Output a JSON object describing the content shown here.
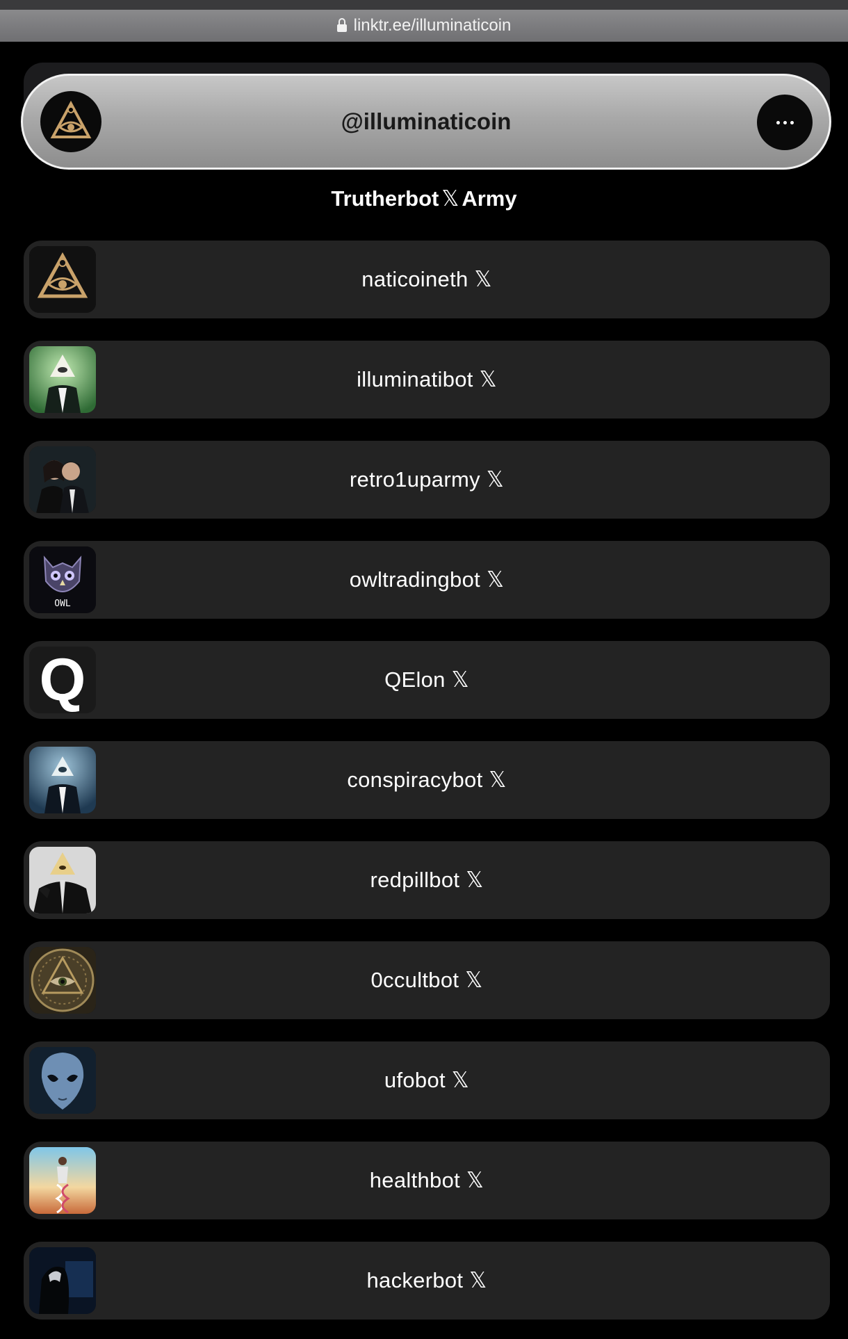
{
  "browser": {
    "url": "linktr.ee/illuminaticoin"
  },
  "profile": {
    "handle": "@illuminaticoin",
    "avatar_icon": "eye-triangle-icon",
    "more_icon": "more-icon"
  },
  "section": {
    "title_before": "Trutherbot",
    "title_x": "𝕏",
    "title_after": "Army"
  },
  "links": [
    {
      "label": "naticoineth 𝕏",
      "thumb": "eye-triangle-icon"
    },
    {
      "label": "illuminatibot 𝕏",
      "thumb": "pyramid-suit-icon"
    },
    {
      "label": "retro1uparmy 𝕏",
      "thumb": "couple-photo-icon"
    },
    {
      "label": "owltradingbot 𝕏",
      "thumb": "owl-logo-icon",
      "thumb_text": "OWL"
    },
    {
      "label": "QElon 𝕏",
      "thumb": "q-letter-icon",
      "thumb_text": "Q"
    },
    {
      "label": "conspiracybot 𝕏",
      "thumb": "pyramid-head-icon"
    },
    {
      "label": "redpillbot 𝕏",
      "thumb": "pyramid-hands-icon"
    },
    {
      "label": "0ccultbot 𝕏",
      "thumb": "occult-eye-icon"
    },
    {
      "label": "ufobot 𝕏",
      "thumb": "alien-icon"
    },
    {
      "label": "healthbot 𝕏",
      "thumb": "dna-figure-icon"
    },
    {
      "label": "hackerbot 𝕏",
      "thumb": "hacker-icon"
    }
  ],
  "colors": {
    "background": "#000000",
    "card": "#232323",
    "text": "#ffffff",
    "gold": "#c9a26a"
  }
}
